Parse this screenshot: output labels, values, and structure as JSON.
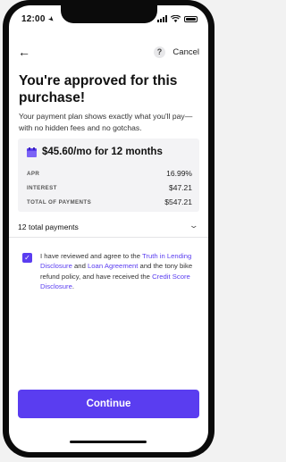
{
  "status_bar": {
    "time": "12:00"
  },
  "header": {
    "help_icon_glyph": "?",
    "cancel_label": "Cancel"
  },
  "title": "You're approved for this purchase!",
  "subtitle": "Your payment plan shows exactly what you'll pay—with no hidden fees and no gotchas.",
  "plan": {
    "icon": "calendar-icon",
    "amount_label": "$45.60/mo for 12 months",
    "rows": [
      {
        "key": "APR",
        "value": "16.99%"
      },
      {
        "key": "INTEREST",
        "value": "$47.21"
      },
      {
        "key": "TOTAL OF PAYMENTS",
        "value": "$547.21"
      }
    ]
  },
  "payments_dropdown": {
    "selected": "12 total payments"
  },
  "agreement": {
    "checked": true,
    "t1": "I have reviewed and agree to the ",
    "link1": "Truth in Lending Disclosure",
    "t2": " and ",
    "link2": "Loan Agreement",
    "t3": " and the tony bike refund policy, and have received the ",
    "link3": "Credit Score Disclosure",
    "t4": "."
  },
  "continue_label": "Continue",
  "colors": {
    "accent": "#5a3df0",
    "card_bg": "#f3f3f5"
  }
}
